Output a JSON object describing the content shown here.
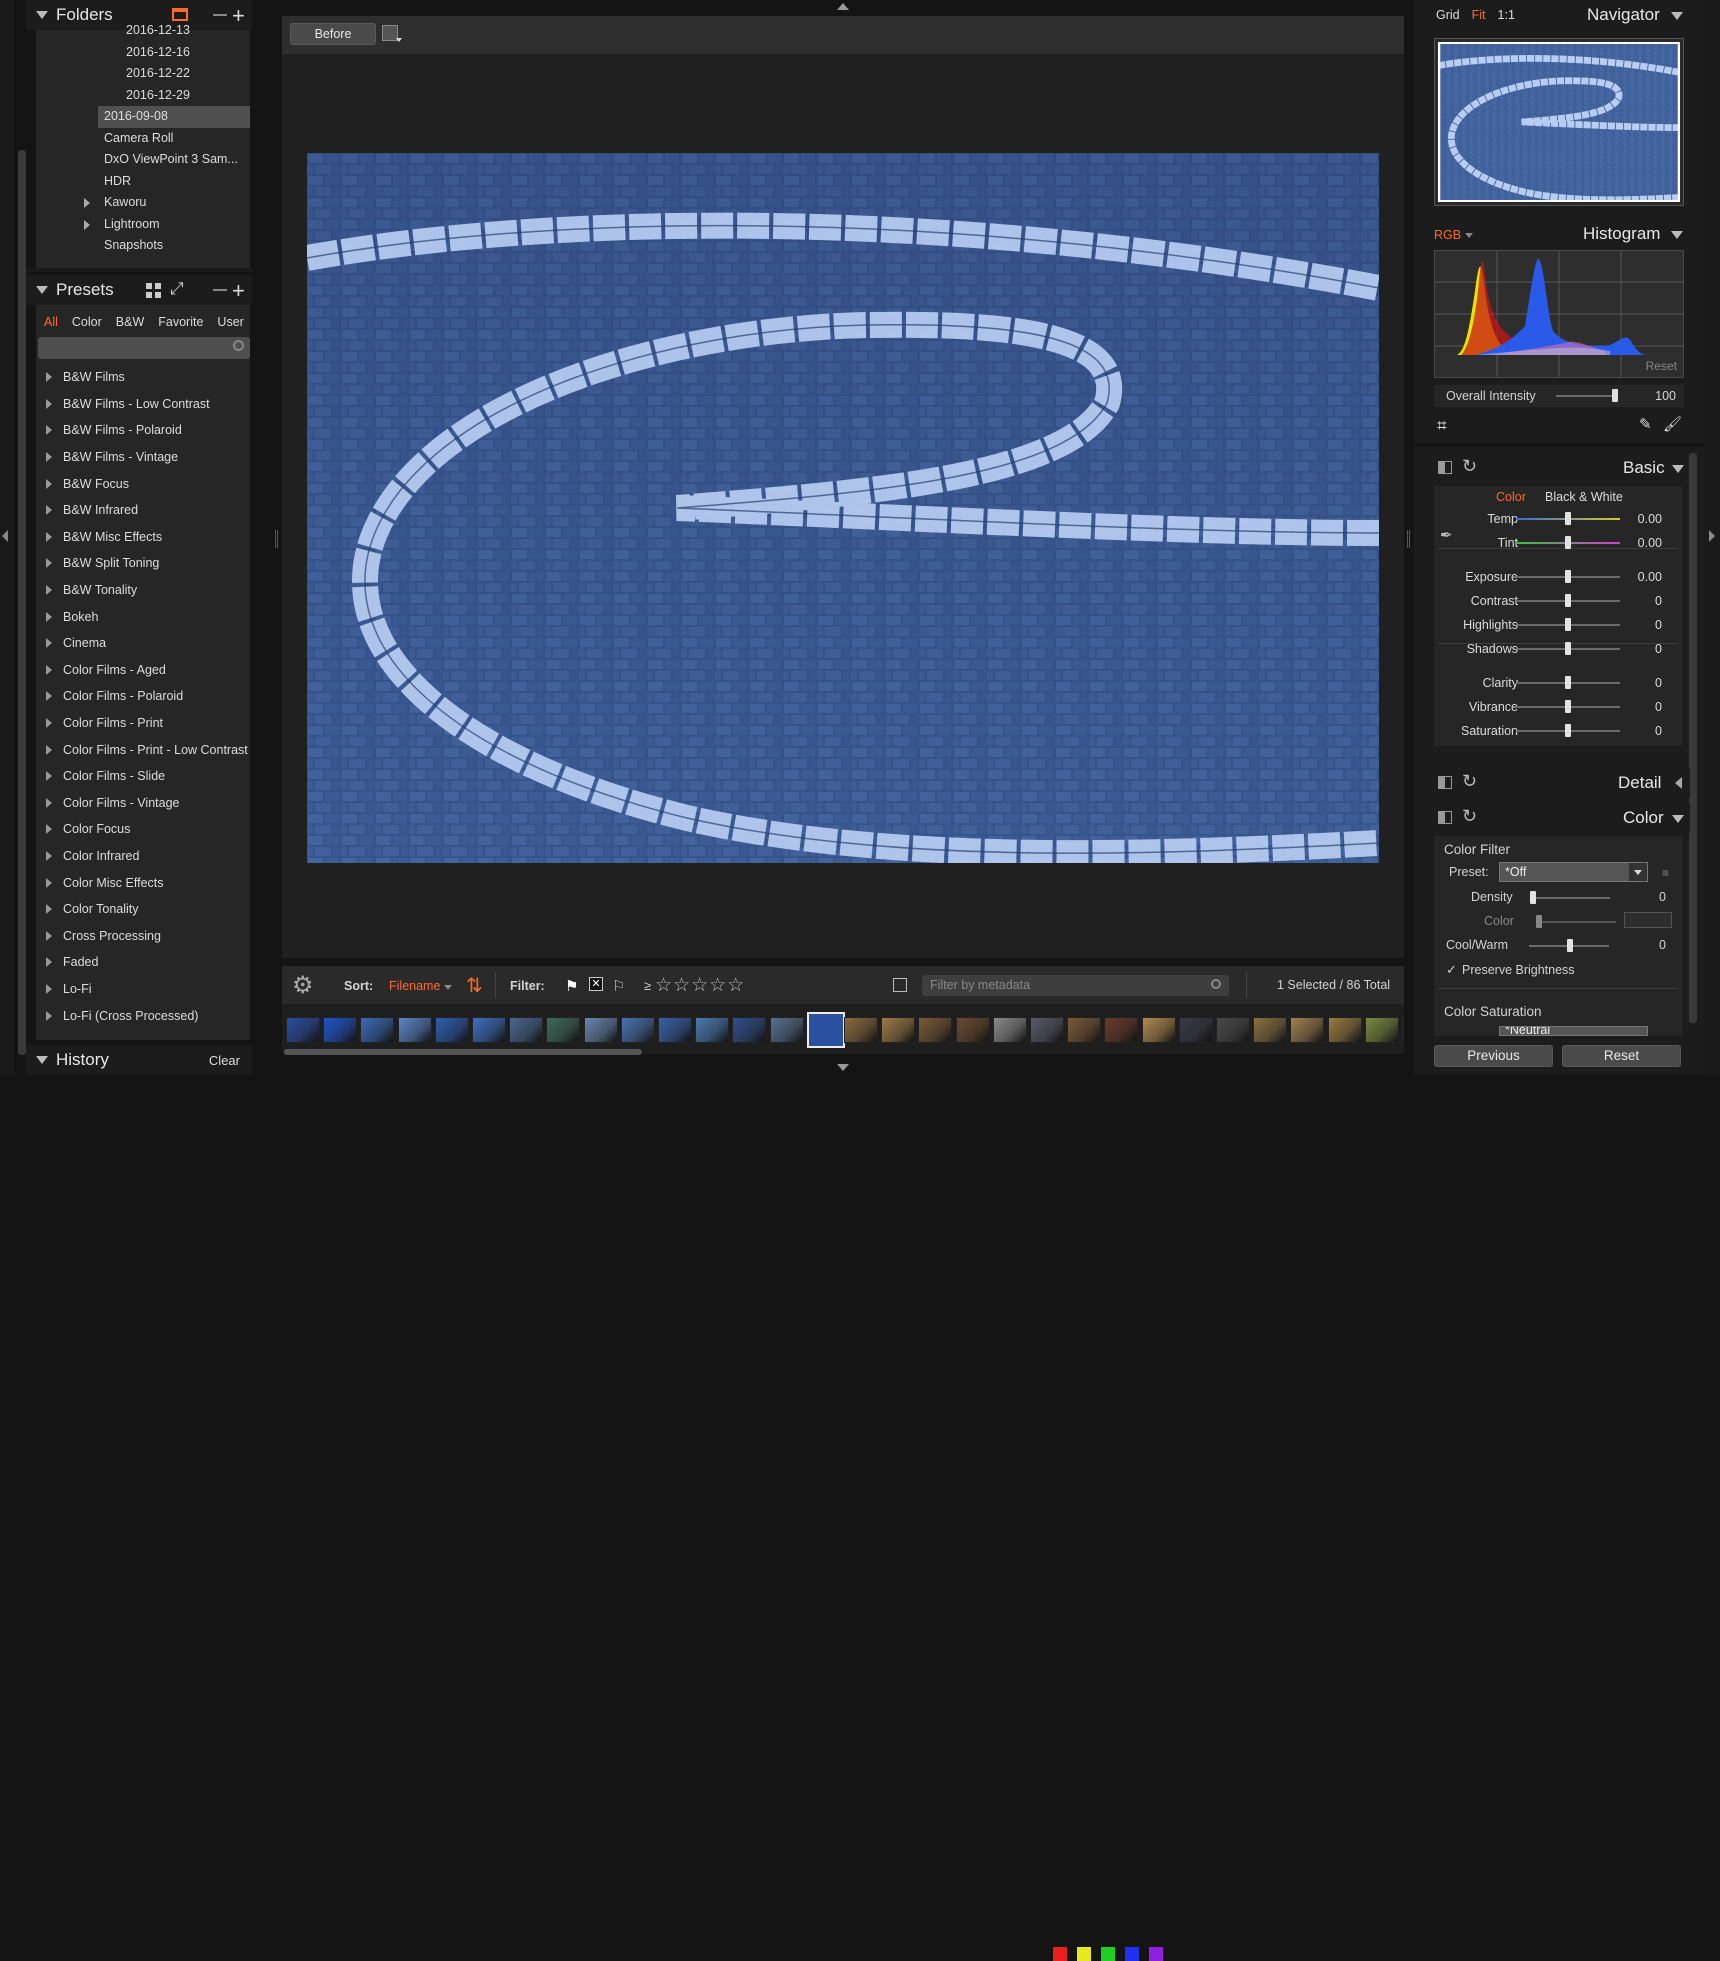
{
  "folders": {
    "title": "Folders",
    "items": [
      {
        "label": "2016-12-13",
        "indent": 2,
        "expand": false,
        "selected": false
      },
      {
        "label": "2016-12-16",
        "indent": 2,
        "expand": false,
        "selected": false
      },
      {
        "label": "2016-12-22",
        "indent": 2,
        "expand": false,
        "selected": false
      },
      {
        "label": "2016-12-29",
        "indent": 2,
        "expand": false,
        "selected": false
      },
      {
        "label": "2016-09-08",
        "indent": 1,
        "expand": false,
        "selected": true
      },
      {
        "label": "Camera Roll",
        "indent": 1,
        "expand": false,
        "selected": false
      },
      {
        "label": "DxO ViewPoint 3 Sam...",
        "indent": 1,
        "expand": false,
        "selected": false
      },
      {
        "label": "HDR",
        "indent": 1,
        "expand": false,
        "selected": false
      },
      {
        "label": "Kaworu",
        "indent": 1,
        "expand": true,
        "selected": false
      },
      {
        "label": "Lightroom",
        "indent": 1,
        "expand": true,
        "selected": false
      },
      {
        "label": "Snapshots",
        "indent": 1,
        "expand": false,
        "selected": false
      }
    ]
  },
  "presets": {
    "title": "Presets",
    "tabs": [
      "All",
      "Color",
      "B&W",
      "Favorite",
      "User"
    ],
    "active_tab": "All",
    "search_placeholder": "",
    "items": [
      "B&W Films",
      "B&W Films - Low Contrast",
      "B&W Films - Polaroid",
      "B&W Films - Vintage",
      "B&W Focus",
      "B&W Infrared",
      "B&W Misc Effects",
      "B&W Split Toning",
      "B&W Tonality",
      "Bokeh",
      "Cinema",
      "Color Films - Aged",
      "Color Films - Polaroid",
      "Color Films - Print",
      "Color Films - Print - Low Contrast",
      "Color Films - Slide",
      "Color Films - Vintage",
      "Color Focus",
      "Color Infrared",
      "Color Misc Effects",
      "Color Tonality",
      "Cross Processing",
      "Faded",
      "Lo-Fi",
      "Lo-Fi (Cross Processed)"
    ]
  },
  "history": {
    "title": "History",
    "clear_label": "Clear"
  },
  "viewer": {
    "before_label": "Before"
  },
  "toolbar": {
    "sort_label": "Sort:",
    "sort_value": "Filename",
    "filter_label": "Filter:",
    "rating_prefix": "≥",
    "stars": "☆☆☆☆☆",
    "filter_placeholder": "Filter by metadata",
    "selection_count": "1 Selected / 86 Total",
    "color_labels": [
      "#e82020",
      "#e8e820",
      "#20d020",
      "#2030f0",
      "#9020e0"
    ]
  },
  "navigator": {
    "title": "Navigator",
    "modes": [
      "Grid",
      "Fit",
      "1:1"
    ],
    "active_mode": "Fit"
  },
  "histogram": {
    "title": "Histogram",
    "channel": "RGB",
    "reset_label": "Reset",
    "intensity_label": "Overall Intensity",
    "intensity_value": "100",
    "intensity_level": 1.0
  },
  "basic": {
    "title": "Basic",
    "tabs": [
      "Color",
      "Black & White"
    ],
    "active_tab": "Color",
    "sliders": [
      {
        "label": "Temp",
        "value": "0.00",
        "pos": 0.5,
        "track": "temp"
      },
      {
        "label": "Tint",
        "value": "0.00",
        "pos": 0.5,
        "track": "tint"
      },
      {
        "label": "Exposure",
        "value": "0.00",
        "pos": 0.5,
        "track": "plain"
      },
      {
        "label": "Contrast",
        "value": "0",
        "pos": 0.5,
        "track": "plain"
      },
      {
        "label": "Highlights",
        "value": "0",
        "pos": 0.5,
        "track": "plain"
      },
      {
        "label": "Shadows",
        "value": "0",
        "pos": 0.5,
        "track": "plain"
      },
      {
        "label": "Clarity",
        "value": "0",
        "pos": 0.5,
        "track": "plain"
      },
      {
        "label": "Vibrance",
        "value": "0",
        "pos": 0.5,
        "track": "plain"
      },
      {
        "label": "Saturation",
        "value": "0",
        "pos": 0.5,
        "track": "plain"
      }
    ]
  },
  "detail": {
    "title": "Detail"
  },
  "color": {
    "title": "Color",
    "filter_title": "Color Filter",
    "preset_label": "Preset:",
    "preset_value": "*Off",
    "density_label": "Density",
    "density_value": "0",
    "color_label": "Color",
    "coolwarm_label": "Cool/Warm",
    "coolwarm_value": "0",
    "preserve_label": "Preserve Brightness",
    "preserve_checked": true,
    "saturation_title": "Color Saturation",
    "sat_preset_value": "*Neutral"
  },
  "footer": {
    "previous_label": "Previous",
    "reset_label": "Reset"
  },
  "colors": {
    "accent": "#ff6a2b",
    "panel": "#262626",
    "header": "#1c1c1c"
  }
}
